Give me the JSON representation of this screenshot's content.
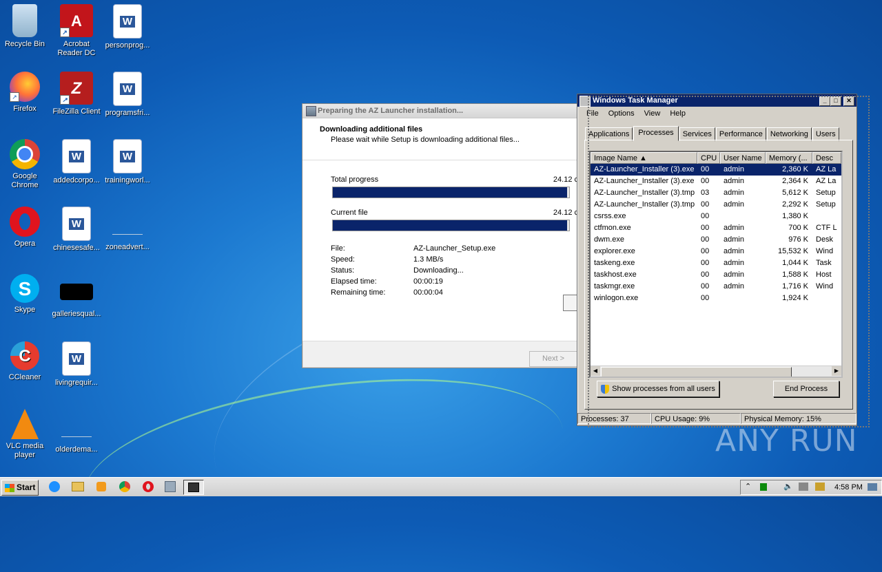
{
  "desktop": {
    "icons": [
      {
        "label": "Recycle Bin",
        "icon": "recycle-bin-icon"
      },
      {
        "label": "Acrobat Reader DC",
        "icon": "acrobat-icon"
      },
      {
        "label": "personprog...",
        "icon": "word-doc-icon"
      },
      {
        "label": "Firefox",
        "icon": "firefox-icon"
      },
      {
        "label": "FileZilla Client",
        "icon": "filezilla-icon"
      },
      {
        "label": "programsfri...",
        "icon": "word-doc-icon"
      },
      {
        "label": "Google Chrome",
        "icon": "chrome-icon"
      },
      {
        "label": "addedcorpo...",
        "icon": "word-doc-icon"
      },
      {
        "label": "trainingworl...",
        "icon": "word-doc-icon"
      },
      {
        "label": "Opera",
        "icon": "opera-icon"
      },
      {
        "label": "chinesesafe...",
        "icon": "word-doc-icon"
      },
      {
        "label": "zoneadvert...",
        "icon": "blank-file-icon"
      },
      {
        "label": "Skype",
        "icon": "skype-icon"
      },
      {
        "label": "galleriesqual...",
        "icon": "black-file-icon"
      },
      {
        "label": "CCleaner",
        "icon": "ccleaner-icon"
      },
      {
        "label": "livingrequir...",
        "icon": "word-doc-icon"
      },
      {
        "label": "VLC media player",
        "icon": "vlc-icon"
      },
      {
        "label": "olderdema...",
        "icon": "blank-file-icon"
      }
    ]
  },
  "installer": {
    "title": "Preparing the AZ Launcher installation...",
    "heading": "Downloading additional files",
    "subheading": "Please wait while Setup is downloading additional files...",
    "total_label": "Total progress",
    "total_value": "24.12 c",
    "total_fraction": 0.99,
    "current_label": "Current file",
    "current_value": "24.12 c",
    "current_fraction": 0.99,
    "fields": [
      {
        "key": "File:",
        "value": "AZ-Launcher_Setup.exe"
      },
      {
        "key": "Speed:",
        "value": "1.3 MB/s"
      },
      {
        "key": "Status:",
        "value": "Downloading..."
      },
      {
        "key": "Elapsed time:",
        "value": "00:00:19"
      },
      {
        "key": "Remaining time:",
        "value": "00:00:04"
      }
    ],
    "next_label": "Next >"
  },
  "taskmgr": {
    "title": "Windows Task Manager",
    "menu": [
      "File",
      "Options",
      "View",
      "Help"
    ],
    "tabs": [
      "Applications",
      "Processes",
      "Services",
      "Performance",
      "Networking",
      "Users"
    ],
    "active_tab": "Processes",
    "columns": [
      "Image Name",
      "CPU",
      "User Name",
      "Memory (...",
      "Desc"
    ],
    "rows": [
      [
        "AZ-Launcher_Installer (3).exe",
        "00",
        "admin",
        "2,360 K",
        "AZ La"
      ],
      [
        "AZ-Launcher_Installer (3).exe",
        "00",
        "admin",
        "2,364 K",
        "AZ La"
      ],
      [
        "AZ-Launcher_Installer (3).tmp",
        "03",
        "admin",
        "5,612 K",
        "Setup"
      ],
      [
        "AZ-Launcher_Installer (3).tmp",
        "00",
        "admin",
        "2,292 K",
        "Setup"
      ],
      [
        "csrss.exe",
        "00",
        "",
        "1,380 K",
        ""
      ],
      [
        "ctfmon.exe",
        "00",
        "admin",
        "700 K",
        "CTF L"
      ],
      [
        "dwm.exe",
        "00",
        "admin",
        "976 K",
        "Desk"
      ],
      [
        "explorer.exe",
        "00",
        "admin",
        "15,532 K",
        "Wind"
      ],
      [
        "taskeng.exe",
        "00",
        "admin",
        "1,044 K",
        "Task"
      ],
      [
        "taskhost.exe",
        "00",
        "admin",
        "1,588 K",
        "Host"
      ],
      [
        "taskmgr.exe",
        "00",
        "admin",
        "1,716 K",
        "Wind"
      ],
      [
        "winlogon.exe",
        "00",
        "",
        "1,924 K",
        ""
      ]
    ],
    "selected_row": 0,
    "show_all_label": "Show processes from all users",
    "end_process_label": "End Process",
    "status_processes": "Processes: 37",
    "status_cpu": "CPU Usage: 9%",
    "status_memory": "Physical Memory: 15%"
  },
  "taskbar": {
    "start_label": "Start",
    "clock": "4:58 PM"
  },
  "watermark": "ANY RUN"
}
